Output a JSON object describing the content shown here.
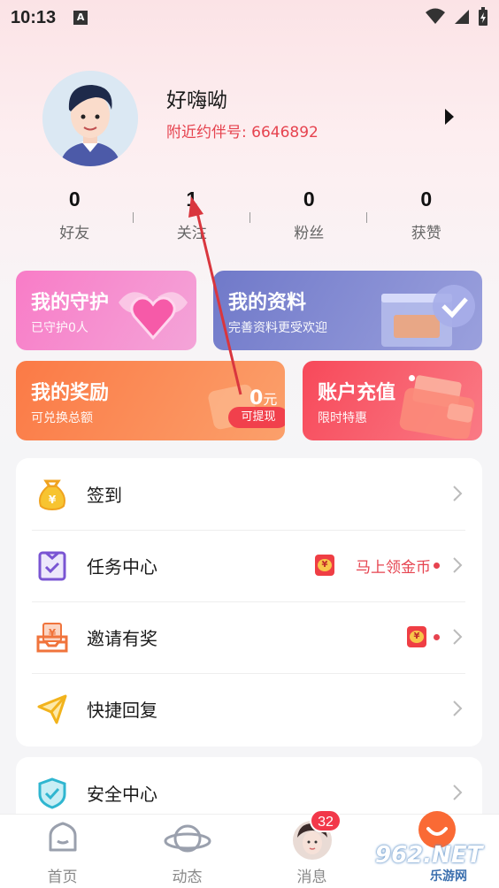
{
  "status_bar": {
    "time": "10:13",
    "notification_badge": "A"
  },
  "profile": {
    "nickname": "好嗨呦",
    "nearby_id": "附近约伴号: 6646892"
  },
  "stats": [
    {
      "value": "0",
      "label": "好友"
    },
    {
      "value": "1",
      "label": "关注"
    },
    {
      "value": "0",
      "label": "粉丝"
    },
    {
      "value": "0",
      "label": "获赞"
    }
  ],
  "cards": {
    "guard": {
      "title": "我的守护",
      "subtitle": "已守护0人"
    },
    "profile": {
      "title": "我的资料",
      "subtitle": "完善资料更受欢迎"
    },
    "reward": {
      "title": "我的奖励",
      "subtitle": "可兑换总额",
      "amount": "0",
      "unit": "元",
      "withdraw_label": "可提现"
    },
    "recharge": {
      "title": "账户充值",
      "subtitle": "限时特惠"
    }
  },
  "menu": {
    "checkin": "签到",
    "tasks": "任务中心",
    "tasks_promo": "马上领金币",
    "invite": "邀请有奖",
    "quick_reply": "快捷回复",
    "security": "安全中心"
  },
  "tabbar": {
    "home": "首页",
    "moments": "动态",
    "messages": "消息",
    "messages_badge": "32"
  },
  "watermark": {
    "main": "962.NET",
    "sub": "乐游网"
  },
  "colors": {
    "accent_red": "#e6434f",
    "guard_pink": "#f87cc7",
    "profile_purple": "#7079c9",
    "reward_orange": "#fb7a46",
    "recharge_red": "#f7495a"
  }
}
